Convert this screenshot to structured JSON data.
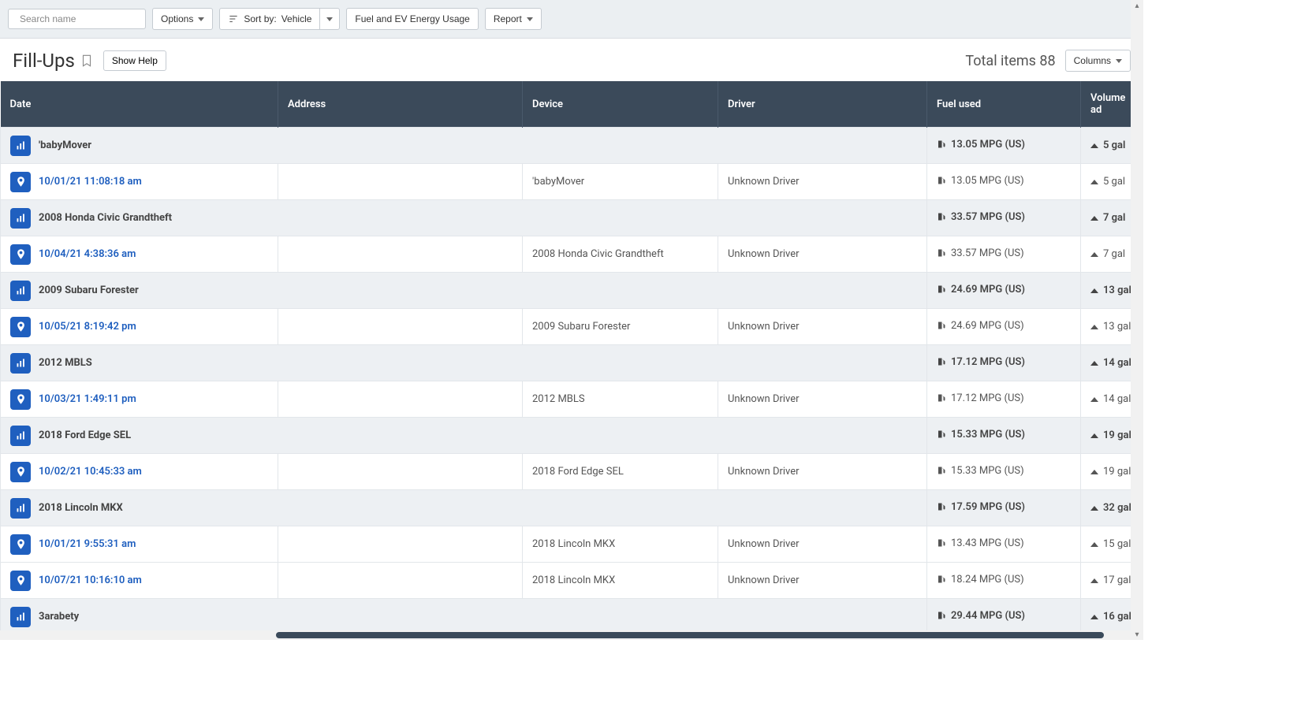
{
  "toolbar": {
    "search_placeholder": "Search name",
    "options_label": "Options",
    "sort_prefix": "Sort by:",
    "sort_value": "Vehicle",
    "filter_label": "Fuel and EV Energy Usage",
    "report_label": "Report"
  },
  "header": {
    "title": "Fill-Ups",
    "show_help": "Show Help",
    "total_items_label": "Total items",
    "total_items_value": "88",
    "columns_label": "Columns"
  },
  "columns": {
    "date": "Date",
    "address": "Address",
    "device": "Device",
    "driver": "Driver",
    "fuel": "Fuel used",
    "volume": "Volume ad"
  },
  "rows": [
    {
      "type": "group",
      "name": "'babyMover",
      "fuel": "13.05 MPG (US)",
      "volume": "5 gal"
    },
    {
      "type": "data",
      "date": "10/01/21 11:08:18 am",
      "device": "'babyMover",
      "driver": "Unknown Driver",
      "fuel": "13.05 MPG (US)",
      "volume": "5 gal"
    },
    {
      "type": "group",
      "name": "2008 Honda Civic Grandtheft",
      "fuel": "33.57 MPG (US)",
      "volume": "7 gal"
    },
    {
      "type": "data",
      "date": "10/04/21 4:38:36 am",
      "device": "2008 Honda Civic Grandtheft",
      "driver": "Unknown Driver",
      "fuel": "33.57 MPG (US)",
      "volume": "7 gal"
    },
    {
      "type": "group",
      "name": "2009 Subaru Forester",
      "fuel": "24.69 MPG (US)",
      "volume": "13 gal"
    },
    {
      "type": "data",
      "date": "10/05/21 8:19:42 pm",
      "device": "2009 Subaru Forester",
      "driver": "Unknown Driver",
      "fuel": "24.69 MPG (US)",
      "volume": "13 gal"
    },
    {
      "type": "group",
      "name": "2012 MBLS",
      "fuel": "17.12 MPG (US)",
      "volume": "14 gal"
    },
    {
      "type": "data",
      "date": "10/03/21 1:49:11 pm",
      "device": "2012 MBLS",
      "driver": "Unknown Driver",
      "fuel": "17.12 MPG (US)",
      "volume": "14 gal"
    },
    {
      "type": "group",
      "name": "2018 Ford Edge SEL",
      "fuel": "15.33 MPG (US)",
      "volume": "19 gal"
    },
    {
      "type": "data",
      "date": "10/02/21 10:45:33 am",
      "device": "2018 Ford Edge SEL",
      "driver": "Unknown Driver",
      "fuel": "15.33 MPG (US)",
      "volume": "19 gal"
    },
    {
      "type": "group",
      "name": "2018 Lincoln MKX",
      "fuel": "17.59 MPG (US)",
      "volume": "32 gal"
    },
    {
      "type": "data",
      "date": "10/01/21 9:55:31 am",
      "device": "2018 Lincoln MKX",
      "driver": "Unknown Driver",
      "fuel": "13.43 MPG (US)",
      "volume": "15 gal"
    },
    {
      "type": "data",
      "date": "10/07/21 10:16:10 am",
      "device": "2018 Lincoln MKX",
      "driver": "Unknown Driver",
      "fuel": "18.24 MPG (US)",
      "volume": "17 gal"
    },
    {
      "type": "group",
      "name": "3arabety",
      "fuel": "29.44 MPG (US)",
      "volume": "16 gal"
    }
  ]
}
